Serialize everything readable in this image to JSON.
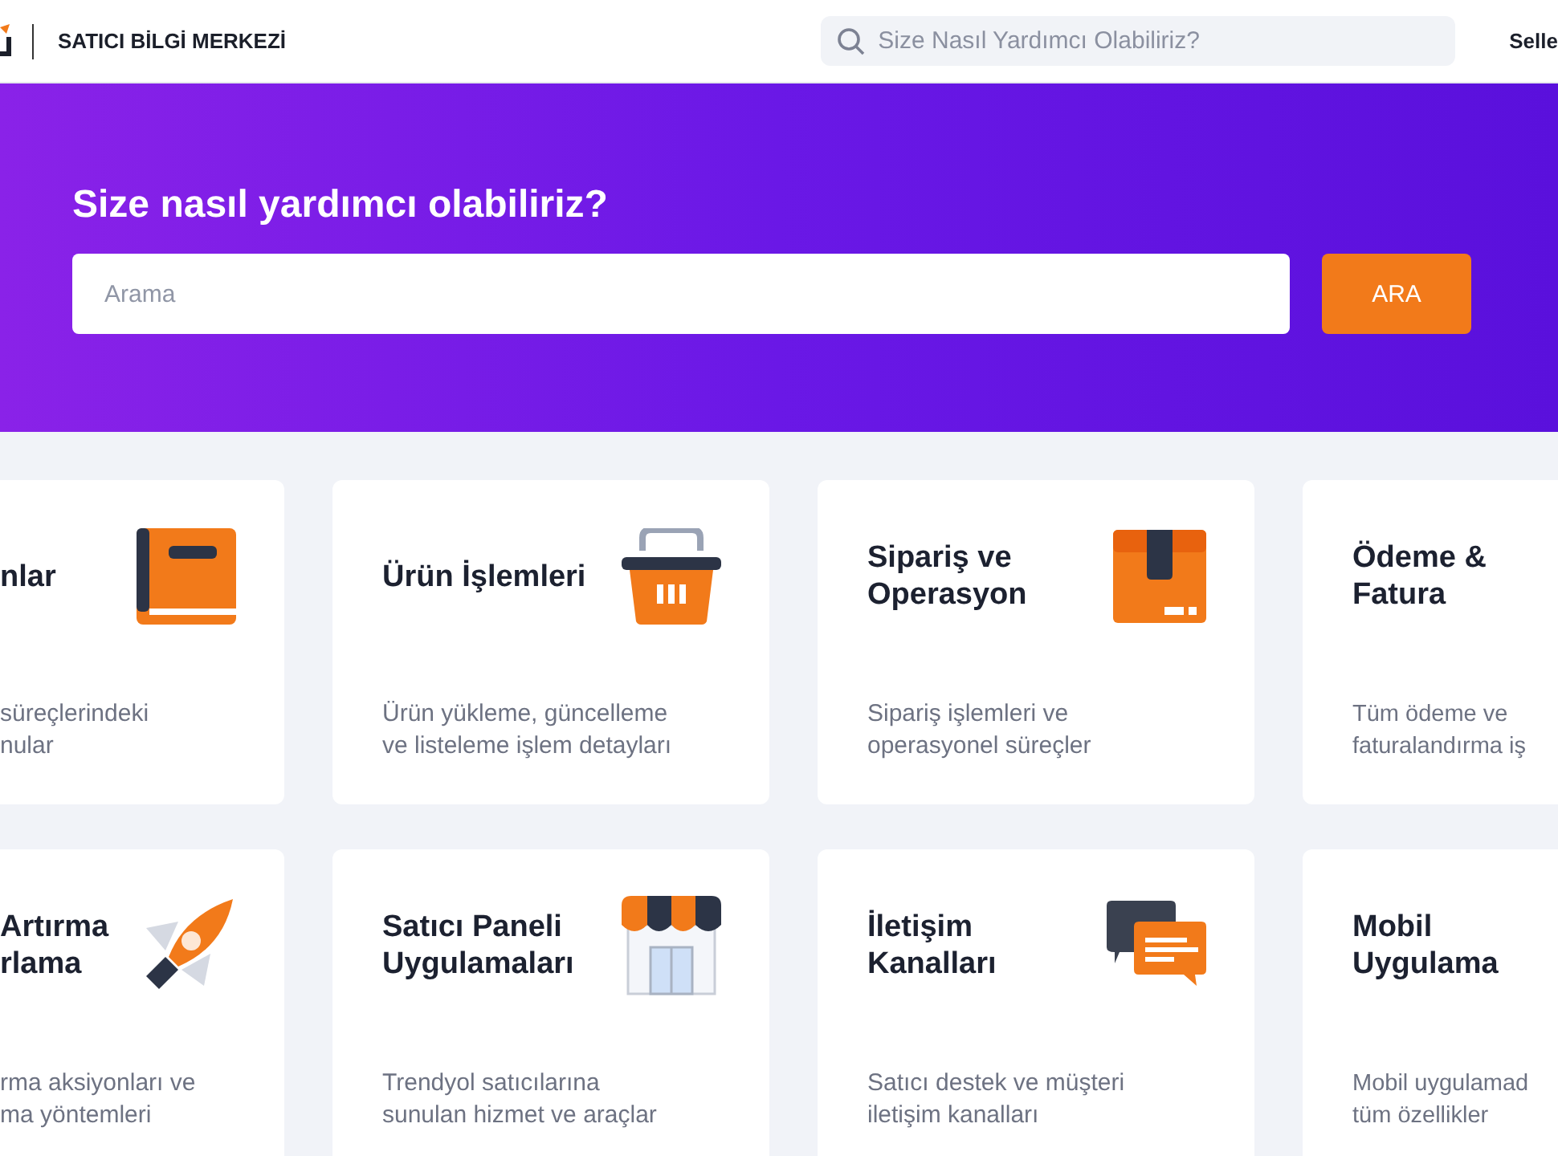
{
  "header": {
    "title": "SATICI BİLGİ MERKEZİ",
    "search_placeholder": "Size Nasıl Yardımcı Olabiliriz?",
    "nav_link": "Selle"
  },
  "hero": {
    "heading": "Size nasıl yardımcı olabiliriz?",
    "search_placeholder": "Arama",
    "button": "ARA"
  },
  "cards": [
    {
      "title_lines": [
        "nlar"
      ],
      "description_lines": [
        "süreçlerindeki",
        "nular"
      ]
    },
    {
      "title_lines": [
        "Ürün İşlemleri"
      ],
      "description_lines": [
        "Ürün yükleme, güncelleme",
        "ve listeleme işlem detayları"
      ]
    },
    {
      "title_lines": [
        "Sipariş ve",
        "Operasyon"
      ],
      "description_lines": [
        "Sipariş işlemleri ve",
        "operasyonel süreçler"
      ]
    },
    {
      "title_lines": [
        "Ödeme &",
        "Fatura"
      ],
      "description_lines": [
        "Tüm ödeme ve",
        "faturalandırma iş"
      ]
    },
    {
      "title_lines": [
        "Artırma",
        "rlama"
      ],
      "description_lines": [
        "rma aksiyonları ve",
        "ma yöntemleri"
      ]
    },
    {
      "title_lines": [
        "Satıcı Paneli",
        "Uygulamaları"
      ],
      "description_lines": [
        "Trendyol satıcılarına",
        "sunulan hizmet ve araçlar"
      ]
    },
    {
      "title_lines": [
        "İletişim",
        "Kanalları"
      ],
      "description_lines": [
        "Satıcı destek ve müşteri",
        "iletişim kanalları"
      ]
    },
    {
      "title_lines": [
        "Mobil",
        "Uygulama"
      ],
      "description_lines": [
        "Mobil uygulamad",
        "tüm özellikler"
      ]
    }
  ]
}
